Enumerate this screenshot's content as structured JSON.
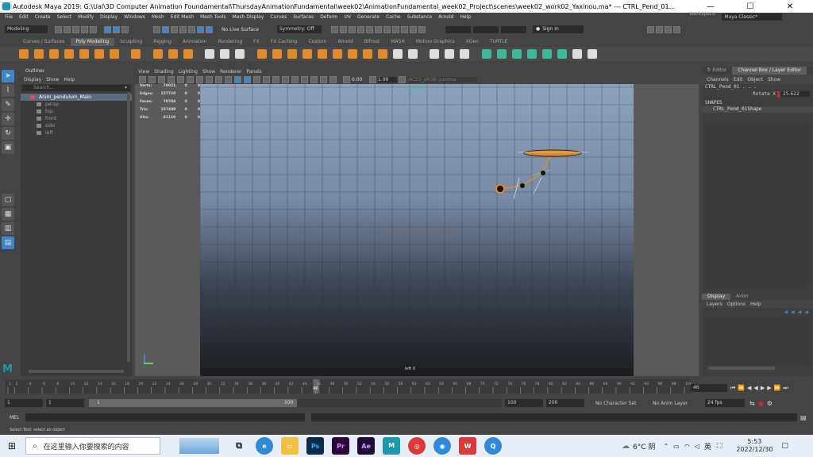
{
  "titlebar": {
    "title": "Autodesk Maya 2019: G:\\Ual\\3D Computer Animation Foundamental\\ThursdayAnimationFundamental\\week02\\AnimationFundamental_week02_Project\\scenes\\week02_work02_Yaxinou.ma*   ---   CTRL_Pend_01...",
    "min": "—",
    "max": "☐",
    "close": "✕"
  },
  "menu": [
    "File",
    "Edit",
    "Create",
    "Select",
    "Modify",
    "Display",
    "Windows",
    "Mesh",
    "Edit Mesh",
    "Mesh Tools",
    "Mesh Display",
    "Curves",
    "Surfaces",
    "Deform",
    "UV",
    "Generate",
    "Cache",
    "Substance",
    "Arnold",
    "Help"
  ],
  "workspace": {
    "label": "Workspace :",
    "value": "Maya Classic*"
  },
  "status_line": {
    "mode": "Modeling",
    "live_surface": "No Live Surface",
    "symmetry": "Symmetry: Off",
    "sign_in": "Sign In"
  },
  "shelf_tabs": [
    "Curves / Surfaces",
    "Poly Modeling",
    "Sculpting",
    "Rigging",
    "Animation",
    "Rendering",
    "FX",
    "FX Caching",
    "Custom",
    "Arnold",
    "Bifrost",
    "MASH",
    "Motion Graphics",
    "XGen",
    "TURTLE"
  ],
  "shelf_active": "Poly Modeling",
  "outliner": {
    "title": "Outliner",
    "menus": [
      "Display",
      "Show",
      "Help"
    ],
    "search_placeholder": "Search...",
    "items": [
      "Anim_pendulum_Main",
      "persp",
      "top",
      "front",
      "side",
      "left"
    ]
  },
  "viewport": {
    "menus": [
      "View",
      "Shading",
      "Lighting",
      "Show",
      "Renderer",
      "Panels"
    ],
    "field1": "0.00",
    "field2": "1.00",
    "color_space": "ACES_sRGB gamma",
    "resolution": "1024 x 768",
    "camera": "left X",
    "hud": [
      {
        "label": "Verts:",
        "v1": "79021",
        "v2": "0",
        "v3": "0"
      },
      {
        "label": "Edges:",
        "v1": "157720",
        "v2": "0",
        "v3": "0"
      },
      {
        "label": "Faces:",
        "v1": "78704",
        "v2": "0",
        "v3": "0"
      },
      {
        "label": "Tris:",
        "v1": "157408",
        "v2": "0",
        "v3": "0"
      },
      {
        "label": "UVs:",
        "v1": "81120",
        "v2": "0",
        "v3": "0"
      }
    ]
  },
  "channel_box": {
    "tabs": [
      "fr Editor",
      "Channel Box / Layer Editor"
    ],
    "menus": [
      "Channels",
      "Edit",
      "Object",
      "Show"
    ],
    "object": "CTRL_Pend_01 . . .",
    "attr_label": "Rotate X",
    "attr_value": "25.622",
    "shapes_header": "SHAPES",
    "shape_name": "CTRL_Pend_01Shape",
    "layer_tabs": [
      "Display",
      "Anim"
    ],
    "layer_menus": [
      "Layers",
      "Options",
      "Help"
    ]
  },
  "timeline": {
    "ticks": [
      "1",
      "2",
      "4",
      "6",
      "8",
      "10",
      "12",
      "14",
      "16",
      "18",
      "20",
      "22",
      "24",
      "26",
      "28",
      "30",
      "32",
      "34",
      "36",
      "38",
      "40",
      "42",
      "44",
      "46",
      "48",
      "50",
      "52",
      "54",
      "56",
      "58",
      "60",
      "62",
      "64",
      "66",
      "68",
      "70",
      "72",
      "74",
      "76",
      "78",
      "80",
      "82",
      "84",
      "86",
      "88",
      "90",
      "92",
      "94",
      "96",
      "98",
      "100"
    ],
    "current_frame": "46",
    "current_frame_field": "46"
  },
  "range": {
    "start": "1",
    "start2": "1",
    "slider_start": "1",
    "slider_end": "100",
    "end": "100",
    "end2": "200",
    "char_set": "No Character Set",
    "anim_layer": "No Anim Layer",
    "fps": "24 fps"
  },
  "command": {
    "label": "MEL"
  },
  "help_line": "Select Tool: select an object",
  "taskbar": {
    "search_placeholder": "在这里输入你要搜索的内容",
    "weather": "6°C 阴",
    "ime": "英",
    "time": "5:53",
    "date": "2022/12/30"
  },
  "colors": {
    "maya_bg": "#444444",
    "accent": "#3f86c8",
    "orange": "#e08a2c",
    "teal": "#3db79a",
    "viewport_sky": "#8ea2bb",
    "viewport_floor": "#1b1d20"
  }
}
